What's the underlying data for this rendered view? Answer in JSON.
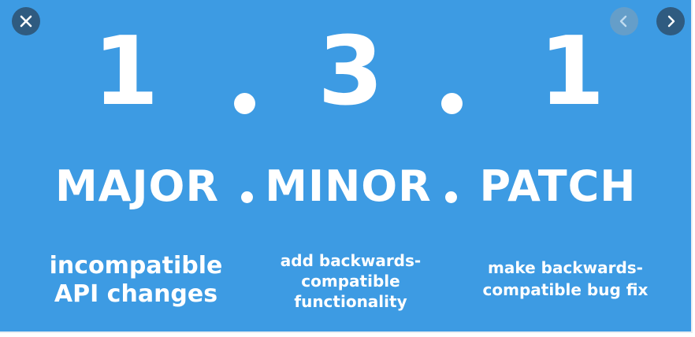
{
  "controls": {
    "close_icon": "close-icon",
    "prev_icon": "chevron-left-icon",
    "next_icon": "chevron-right-icon"
  },
  "slide": {
    "background": "#3d9be3",
    "version": {
      "major": "1",
      "minor": "3",
      "patch": "1",
      "separator": "."
    },
    "labels": {
      "major": "MAJOR",
      "minor": "MINOR",
      "patch": "PATCH"
    },
    "descriptions": {
      "major": [
        "incompatible",
        "API changes"
      ],
      "minor": [
        "add backwards-",
        "compatible",
        "functionality"
      ],
      "patch": [
        "make backwards-",
        "compatible bug fix"
      ]
    }
  }
}
